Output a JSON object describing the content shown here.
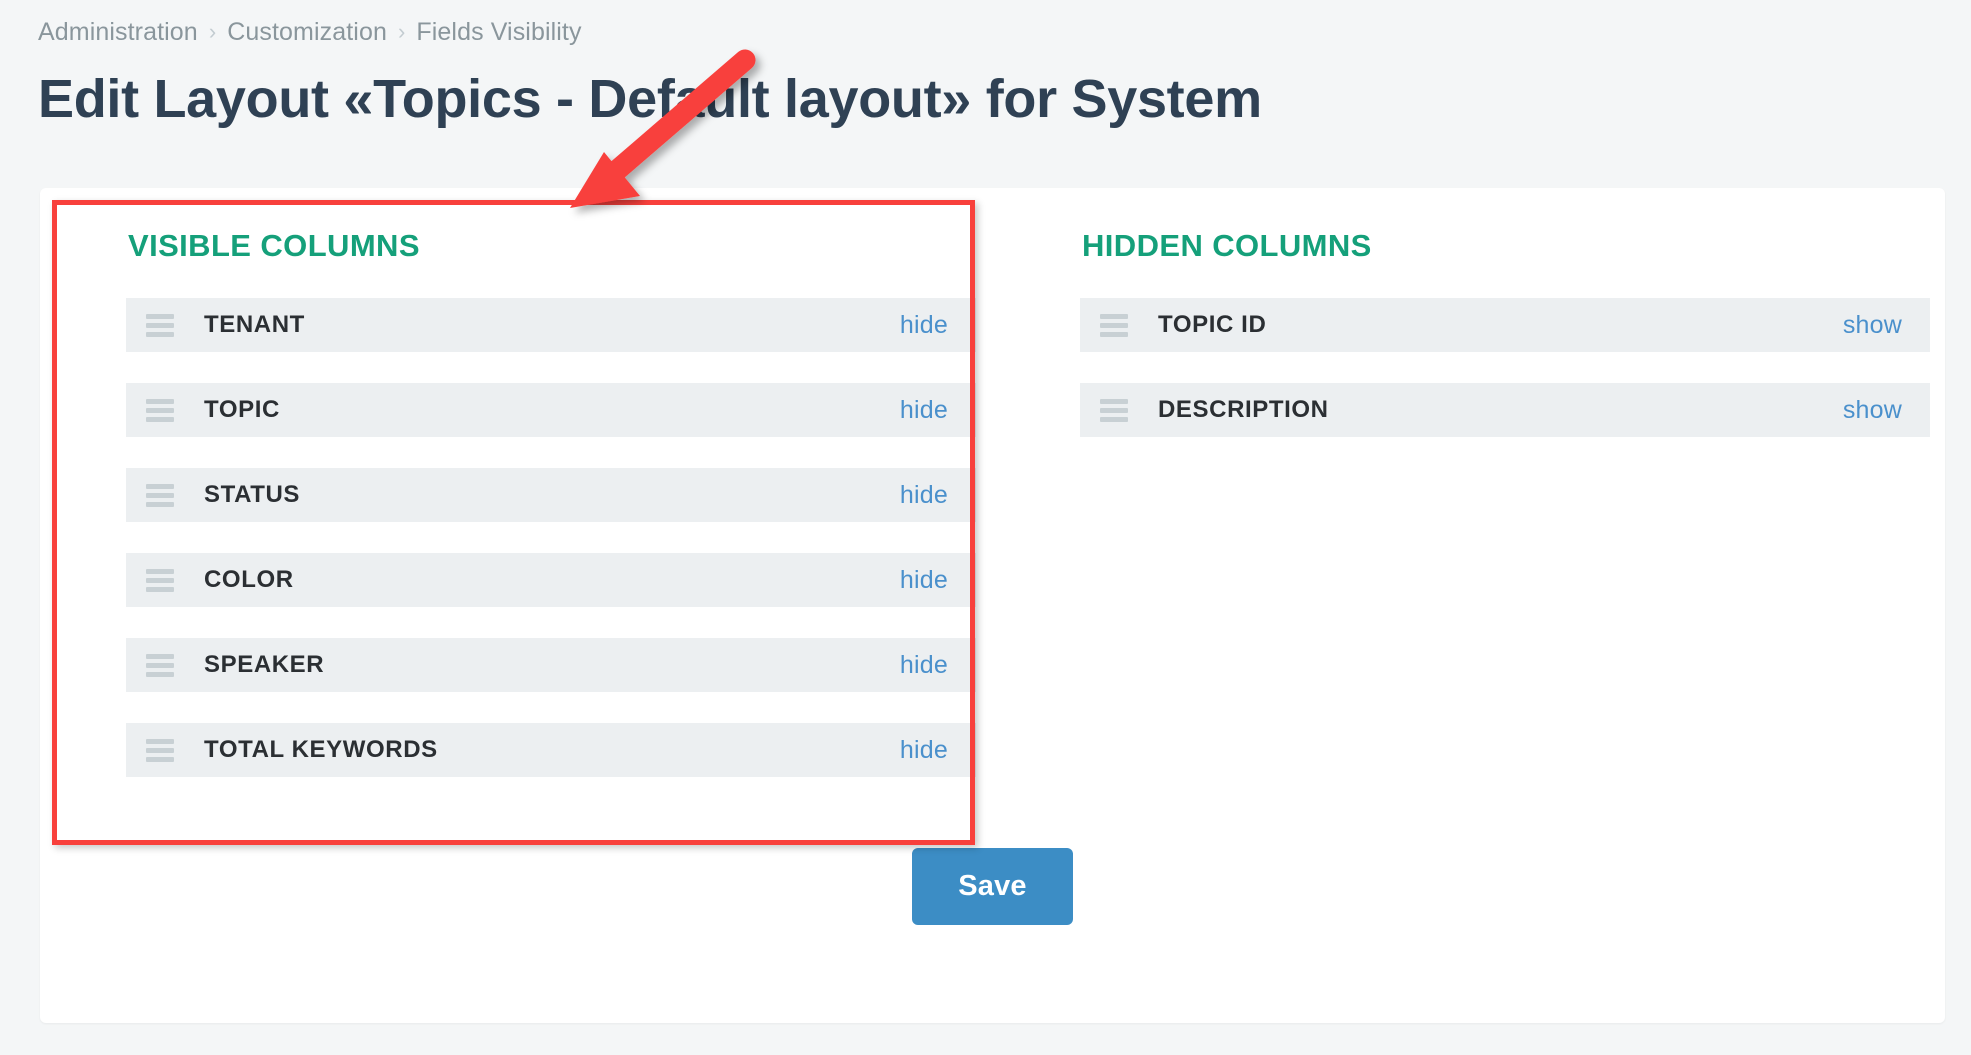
{
  "breadcrumb": {
    "separator": "›",
    "items": [
      {
        "label": "Administration"
      },
      {
        "label": "Customization"
      },
      {
        "label": "Fields Visibility"
      }
    ]
  },
  "header": {
    "title": "Edit Layout «Topics - Default layout» for System"
  },
  "panels": {
    "visible": {
      "heading": "VISIBLE COLUMNS",
      "action_label": "hide",
      "rows": [
        {
          "label": "TENANT",
          "action": "hide"
        },
        {
          "label": "TOPIC",
          "action": "hide"
        },
        {
          "label": "STATUS",
          "action": "hide"
        },
        {
          "label": "COLOR",
          "action": "hide"
        },
        {
          "label": "SPEAKER",
          "action": "hide"
        },
        {
          "label": "TOTAL KEYWORDS",
          "action": "hide"
        }
      ]
    },
    "hidden": {
      "heading": "HIDDEN COLUMNS",
      "action_label": "show",
      "rows": [
        {
          "label": "TOPIC ID",
          "action": "show"
        },
        {
          "label": "DESCRIPTION",
          "action": "show"
        }
      ]
    }
  },
  "footer": {
    "save_label": "Save"
  },
  "annotations": {
    "highlight_target": "visible-columns-panel",
    "arrow_points_to": "visible-columns-panel"
  },
  "colors": {
    "page_background": "#f4f6f7",
    "card_background": "#ffffff",
    "heading_teal": "#15a07a",
    "title_navy": "#2f4154",
    "breadcrumb_gray": "#8a969c",
    "row_background": "#eceff1",
    "link_blue": "#4a90cc",
    "save_blue": "#3c8dc5",
    "annotation_red": "#f8403c",
    "drag_handle_gray": "#c8d0d4"
  },
  "icons": {
    "drag_handle": "drag-handle-icon",
    "breadcrumb_separator": "chevron-right-icon",
    "annotation_arrow": "arrow-icon"
  }
}
